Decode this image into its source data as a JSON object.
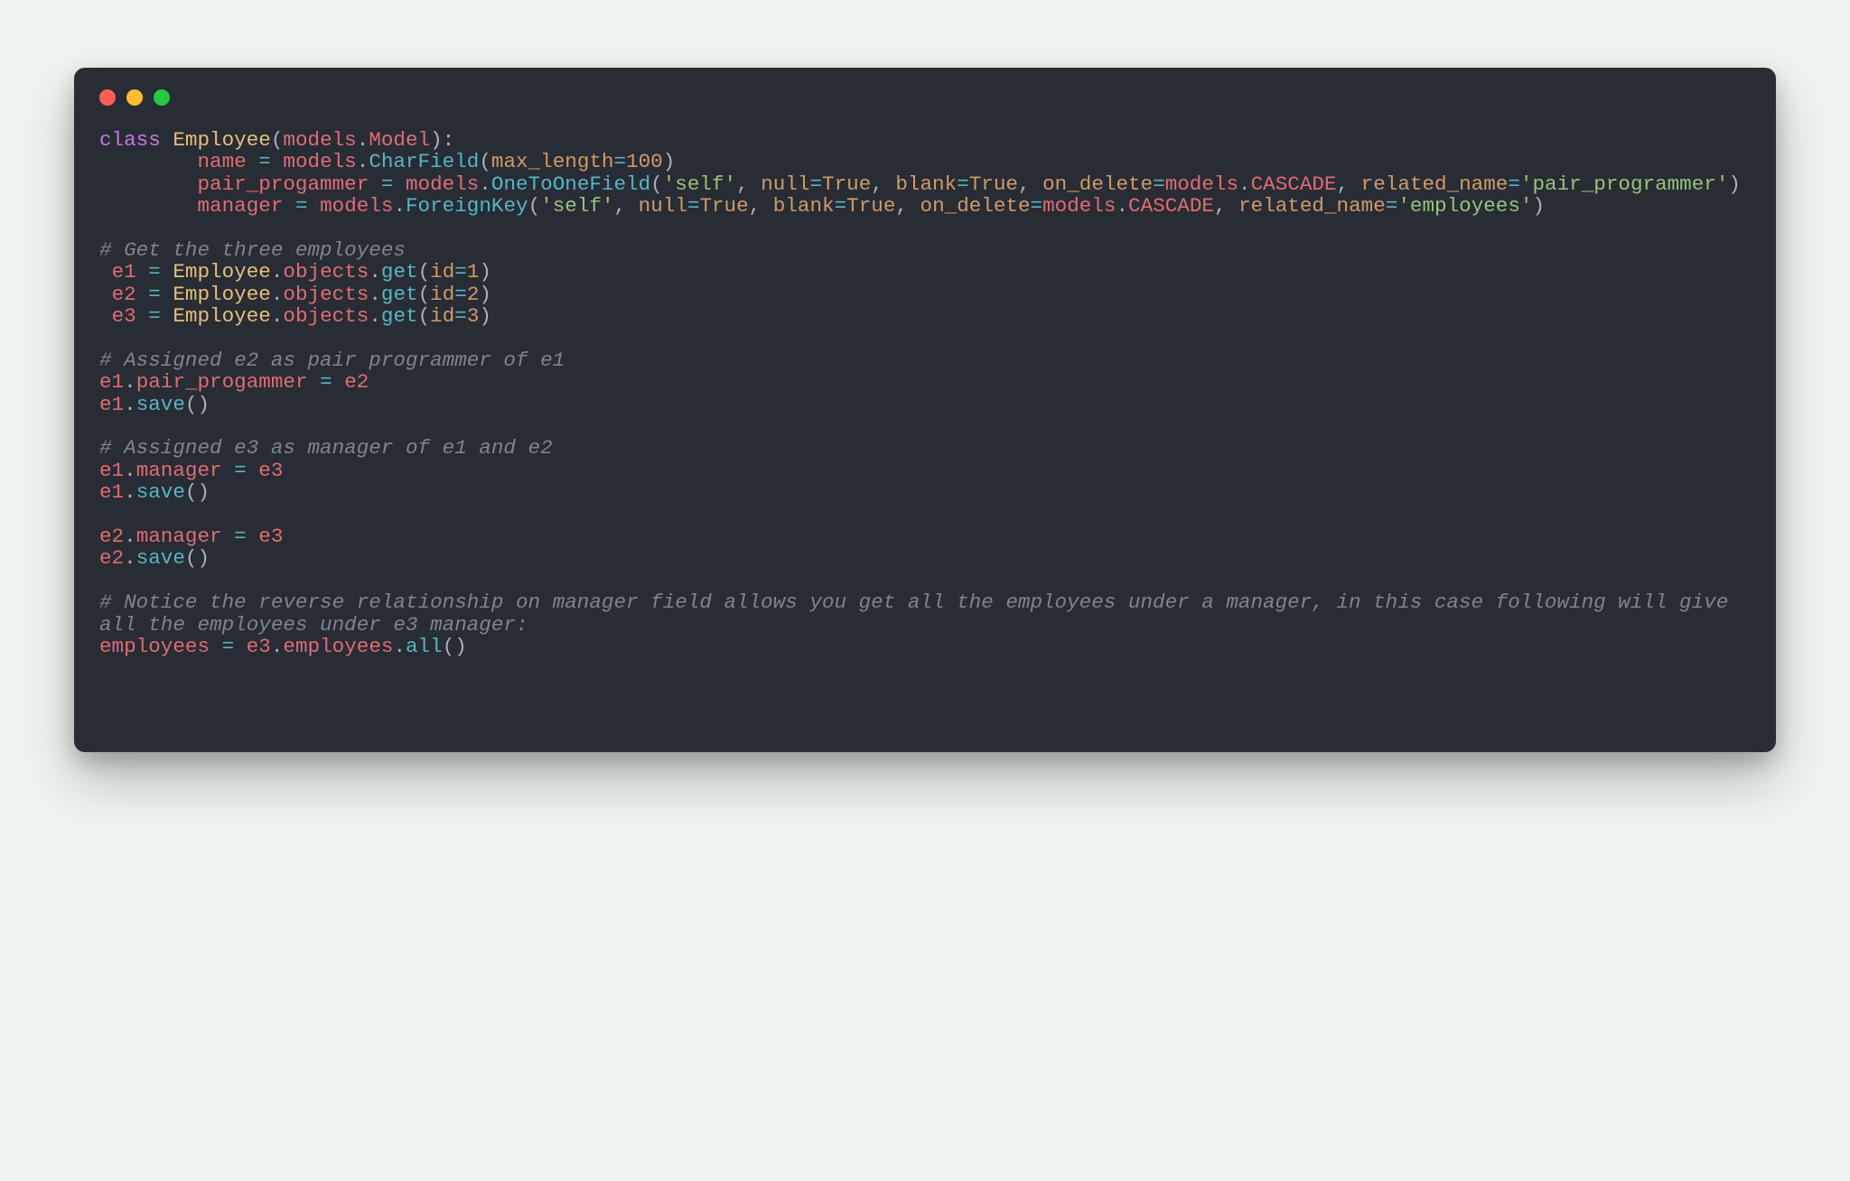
{
  "colors": {
    "page_bg": "#eef5f1",
    "editor_bg": "#282c34",
    "traffic_red": "#ff5f56",
    "traffic_yellow": "#ffbd2e",
    "traffic_green": "#27c93f",
    "fg_default": "#abb2bf",
    "fg_keyword": "#c678dd",
    "fg_class": "#e5c07b",
    "fg_func": "#56b6c2",
    "fg_string": "#98c379",
    "fg_number": "#d19a66",
    "fg_attr": "#e06c75",
    "fg_comment": "#7f848e"
  },
  "t": {
    "kw_class": "class",
    "Employee": "Employee",
    "models": "models",
    "Model": "Model",
    "name": "name",
    "CharField": "CharField",
    "max_length": "max_length",
    "n100": "100",
    "pair_progammer": "pair_progammer",
    "OneToOneField": "OneToOneField",
    "self_str": "'self'",
    "null": "null",
    "True": "True",
    "blank": "blank",
    "on_delete": "on_delete",
    "CASCADE": "CASCADE",
    "related_name": "related_name",
    "pair_programmer_str": "'pair_programmer'",
    "manager": "manager",
    "ForeignKey": "ForeignKey",
    "employees_str": "'employees'",
    "cmt_get3": "# Get the three employees",
    "sp": " ",
    "e1": "e1",
    "e2": "e2",
    "e3": "e3",
    "objects": "objects",
    "get": "get",
    "id": "id",
    "n1": "1",
    "n2": "2",
    "n3": "3",
    "cmt_assign_pair": "# Assigned e2 as pair programmer of e1",
    "save": "save",
    "cmt_assign_mgr": "# Assigned e3 as manager of e1 and e2",
    "cmt_reverse": "# Notice the reverse relationship on manager field allows you get all the employees under a manager, in this case following will give all the employees under e3 manager:",
    "employees_var": "employees",
    "employees_attr": "employees",
    "all": "all",
    "eq": "=",
    "dot": ".",
    "lp": "(",
    "rp": ")",
    "colon": ":",
    "comma": ", "
  }
}
